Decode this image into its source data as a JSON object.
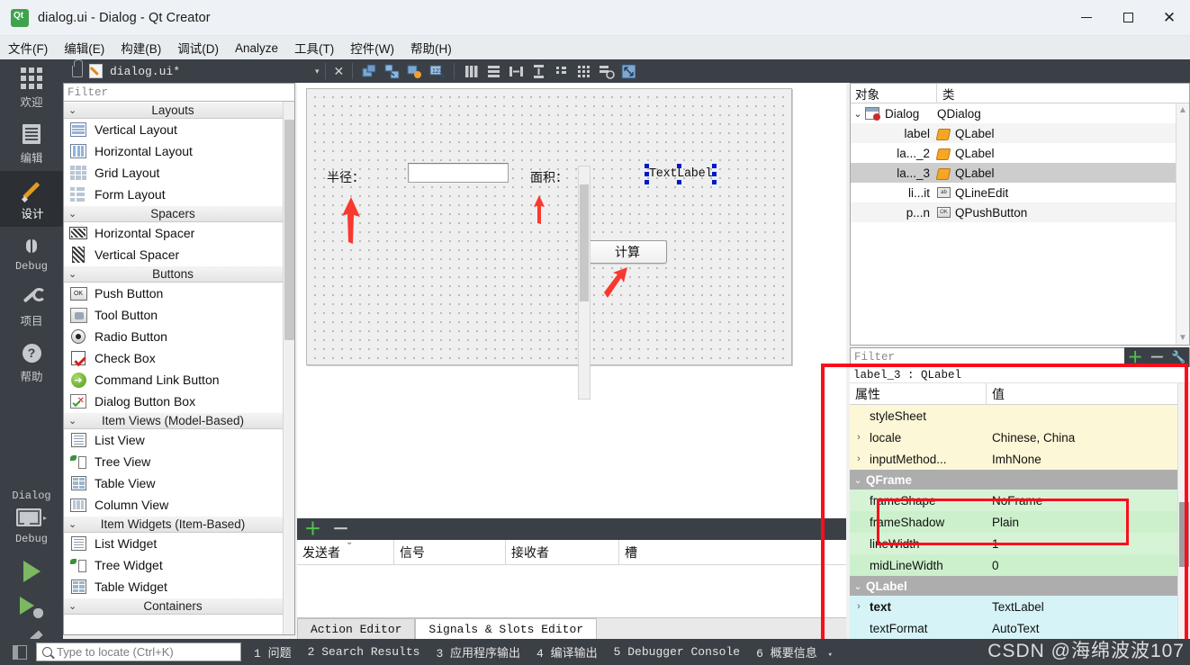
{
  "window": {
    "title": "dialog.ui - Dialog - Qt Creator",
    "app_icon": "qt-logo-icon",
    "minimize": "minimize-icon",
    "maximize": "maximize-icon",
    "close": "close-icon"
  },
  "menubar": {
    "items": [
      {
        "label": "文件(F)",
        "mnemonic": "F"
      },
      {
        "label": "编辑(E)",
        "mnemonic": "E"
      },
      {
        "label": "构建(B)",
        "mnemonic": "B"
      },
      {
        "label": "调试(D)",
        "mnemonic": "D"
      },
      {
        "label": "Analyze",
        "mnemonic": "A"
      },
      {
        "label": "工具(T)",
        "mnemonic": "T"
      },
      {
        "label": "控件(W)",
        "mnemonic": "W"
      },
      {
        "label": "帮助(H)",
        "mnemonic": "H"
      }
    ]
  },
  "toolbar": {
    "lock_icon": "unlock-icon",
    "file_icon": "ui-file-icon",
    "filename": "dialog.ui*",
    "dropdown_caret": "▾",
    "close_label": "✕",
    "buttons": [
      "edit-widgets-icon",
      "edit-signals-slots-icon",
      "edit-buddies-icon",
      "edit-tab-order-icon",
      "layout-horizontal-icon",
      "layout-vertical-icon",
      "layout-splitter-h-icon",
      "layout-splitter-v-icon",
      "layout-form-icon",
      "layout-grid-icon",
      "break-layout-icon",
      "adjust-size-icon"
    ]
  },
  "modebar": {
    "modes": [
      {
        "id": "welcome",
        "label": "欢迎",
        "icon": "grid-icon"
      },
      {
        "id": "edit",
        "label": "编辑",
        "icon": "document-icon"
      },
      {
        "id": "design",
        "label": "设计",
        "icon": "pencil-icon",
        "active": true
      },
      {
        "id": "debug",
        "label": "Debug",
        "icon": "bug-icon"
      },
      {
        "id": "projects",
        "label": "项目",
        "icon": "wrench-icon"
      },
      {
        "id": "help",
        "label": "帮助",
        "icon": "question-circle-icon"
      }
    ],
    "kit_selector": {
      "project_label": "Dialog",
      "build_label": "Debug",
      "icon": "monitor-icon",
      "caret": "▸"
    },
    "actions": [
      {
        "id": "run",
        "icon": "run-triangle-icon"
      },
      {
        "id": "debug-run",
        "icon": "run-debug-icon"
      },
      {
        "id": "build",
        "icon": "hammer-icon"
      }
    ]
  },
  "widgetbox": {
    "filter_placeholder": "Filter",
    "groups": [
      {
        "name": "Layouts",
        "items": [
          {
            "label": "Vertical Layout",
            "icon": "vertical-layout-icon"
          },
          {
            "label": "Horizontal Layout",
            "icon": "horizontal-layout-icon"
          },
          {
            "label": "Grid Layout",
            "icon": "grid-layout-icon"
          },
          {
            "label": "Form Layout",
            "icon": "form-layout-icon"
          }
        ]
      },
      {
        "name": "Spacers",
        "items": [
          {
            "label": "Horizontal Spacer",
            "icon": "horizontal-spacer-icon"
          },
          {
            "label": "Vertical Spacer",
            "icon": "vertical-spacer-icon"
          }
        ]
      },
      {
        "name": "Buttons",
        "items": [
          {
            "label": "Push Button",
            "icon": "push-button-icon"
          },
          {
            "label": "Tool Button",
            "icon": "tool-button-icon"
          },
          {
            "label": "Radio Button",
            "icon": "radio-button-icon"
          },
          {
            "label": "Check Box",
            "icon": "check-box-icon"
          },
          {
            "label": "Command Link Button",
            "icon": "command-link-icon"
          },
          {
            "label": "Dialog Button Box",
            "icon": "dialog-button-box-icon"
          }
        ]
      },
      {
        "name": "Item Views (Model-Based)",
        "items": [
          {
            "label": "List View",
            "icon": "list-view-icon"
          },
          {
            "label": "Tree View",
            "icon": "tree-view-icon"
          },
          {
            "label": "Table View",
            "icon": "table-view-icon"
          },
          {
            "label": "Column View",
            "icon": "column-view-icon"
          }
        ]
      },
      {
        "name": "Item Widgets (Item-Based)",
        "items": [
          {
            "label": "List Widget",
            "icon": "list-widget-icon"
          },
          {
            "label": "Tree Widget",
            "icon": "tree-widget-icon"
          },
          {
            "label": "Table Widget",
            "icon": "table-widget-icon"
          }
        ]
      },
      {
        "name": "Containers",
        "items": []
      }
    ]
  },
  "canvas": {
    "label_radius": "半径：",
    "line_edit_value": "",
    "label_area": "面积：",
    "label_text": "TextLabel",
    "button_calc": "计算",
    "annotation_arrows": 3
  },
  "object_inspector": {
    "col_object": "对象",
    "col_class": "类",
    "rows": [
      {
        "name": "Dialog",
        "cls": "QDialog",
        "icon": "qdialog-icon",
        "expand": "⌄",
        "depth": 0
      },
      {
        "name": "label",
        "cls": "QLabel",
        "icon": "qlabel-icon",
        "depth": 1
      },
      {
        "name": "la..._2",
        "cls": "QLabel",
        "icon": "qlabel-icon",
        "depth": 1
      },
      {
        "name": "la..._3",
        "cls": "QLabel",
        "icon": "qlabel-icon",
        "depth": 1,
        "selected": true
      },
      {
        "name": "li...it",
        "cls": "QLineEdit",
        "icon": "qlineedit-icon",
        "depth": 1
      },
      {
        "name": "p...n",
        "cls": "QPushButton",
        "icon": "qpushbutton-icon",
        "depth": 1
      }
    ]
  },
  "property_editor": {
    "filter_placeholder": "Filter",
    "add_icon": "plus-icon",
    "remove_icon": "minus-icon",
    "config_icon": "wrench-icon",
    "object_line": "label_3 : QLabel",
    "col_property": "属性",
    "col_value": "值",
    "rows": [
      {
        "name": "styleSheet",
        "value": "",
        "style": "yellow",
        "expandable": false
      },
      {
        "name": "locale",
        "value": "Chinese, China",
        "style": "yellow",
        "expandable": true
      },
      {
        "name": "inputMethod...",
        "value": "ImhNone",
        "style": "yellow",
        "expandable": true
      },
      {
        "group": "QFrame"
      },
      {
        "name": "frameShape",
        "value": "NoFrame",
        "style": "green",
        "expandable": false,
        "highlighted": true
      },
      {
        "name": "frameShadow",
        "value": "Plain",
        "style": "green2",
        "expandable": false,
        "highlighted": true
      },
      {
        "name": "lineWidth",
        "value": "1",
        "style": "green",
        "expandable": false
      },
      {
        "name": "midLineWidth",
        "value": "0",
        "style": "green2",
        "expandable": false
      },
      {
        "group": "QLabel"
      },
      {
        "name": "text",
        "value": "TextLabel",
        "style": "cyan",
        "expandable": true,
        "bold": true
      },
      {
        "name": "textFormat",
        "value": "AutoText",
        "style": "cyan",
        "expandable": false
      }
    ]
  },
  "signals_slots_editor": {
    "add_icon": "plus-icon",
    "remove_icon": "minus-icon",
    "columns": [
      "发送者",
      "信号",
      "接收者",
      "槽"
    ],
    "rows": [],
    "tabs": [
      {
        "label": "Action Editor",
        "active": false
      },
      {
        "label": "Signals & Slots Editor",
        "active": true
      }
    ]
  },
  "statusbar": {
    "sidebar_toggle_icon": "sidebar-toggle-icon",
    "search_icon": "search-icon",
    "search_placeholder": "Type to locate (Ctrl+K)",
    "panes": [
      "1 问题",
      "2 Search Results",
      "3 应用程序输出",
      "4 编译输出",
      "5 Debugger Console",
      "6 概要信息"
    ],
    "pane_caret": "▾"
  },
  "watermark": "CSDN @海绵波波107"
}
